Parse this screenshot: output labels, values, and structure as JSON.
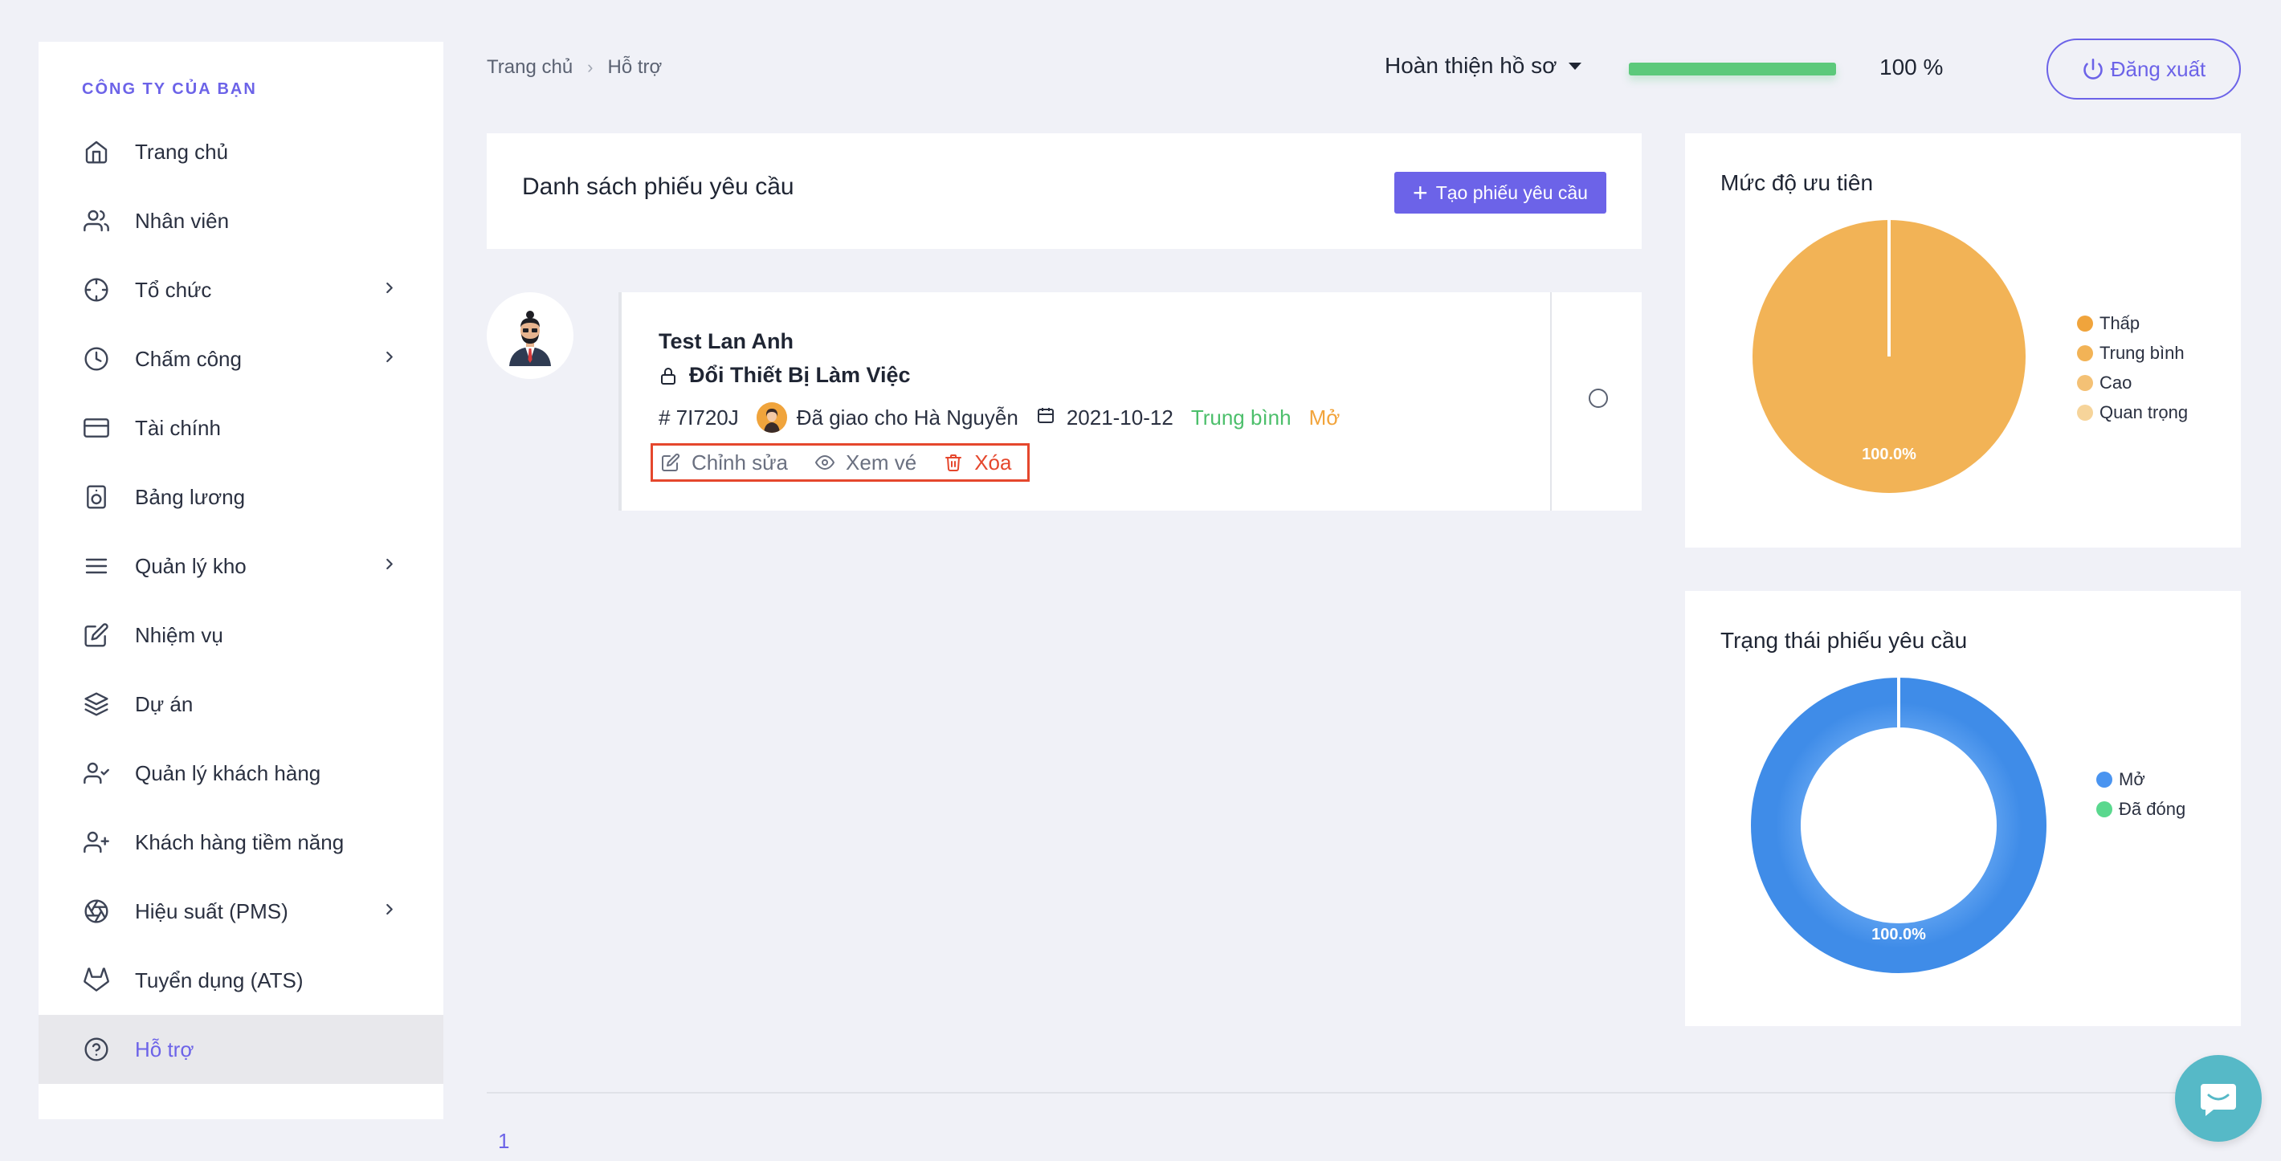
{
  "sidebar": {
    "company": "CÔNG TY CỦA BẠN",
    "items": [
      {
        "label": "Trang chủ",
        "icon": "home-icon",
        "chevron": false,
        "active": false
      },
      {
        "label": "Nhân viên",
        "icon": "users-icon",
        "chevron": false,
        "active": false
      },
      {
        "label": "Tổ chức",
        "icon": "crosshair-icon",
        "chevron": true,
        "active": false
      },
      {
        "label": "Chấm công",
        "icon": "clock-icon",
        "chevron": true,
        "active": false
      },
      {
        "label": "Tài chính",
        "icon": "credit-card-icon",
        "chevron": false,
        "active": false
      },
      {
        "label": "Bảng lương",
        "icon": "speaker-icon",
        "chevron": false,
        "active": false
      },
      {
        "label": "Quản lý kho",
        "icon": "menu-icon",
        "chevron": true,
        "active": false
      },
      {
        "label": "Nhiệm vụ",
        "icon": "edit-icon",
        "chevron": false,
        "active": false
      },
      {
        "label": "Dự án",
        "icon": "layers-icon",
        "chevron": false,
        "active": false
      },
      {
        "label": "Quản lý khách hàng",
        "icon": "user-check-icon",
        "chevron": false,
        "active": false
      },
      {
        "label": "Khách hàng tiềm năng",
        "icon": "user-plus-icon",
        "chevron": false,
        "active": false
      },
      {
        "label": "Hiệu suất (PMS)",
        "icon": "aperture-icon",
        "chevron": true,
        "active": false
      },
      {
        "label": "Tuyển dụng (ATS)",
        "icon": "gitlab-icon",
        "chevron": false,
        "active": false
      },
      {
        "label": "Hỗ trợ",
        "icon": "help-circle-icon",
        "chevron": false,
        "active": true
      }
    ]
  },
  "header": {
    "breadcrumb": {
      "home": "Trang chủ",
      "separator": "›",
      "current": "Hỗ trợ"
    },
    "profile_dropdown": "Hoàn thiện hồ sơ",
    "progress": {
      "value": 100,
      "label": "100 %",
      "color": "#5cc97b"
    },
    "logout_label": "Đăng xuất"
  },
  "tickets": {
    "title": "Danh sách phiếu yêu cầu",
    "create_label": "Tạo phiếu yêu cầu",
    "items": [
      {
        "name": "Test Lan Anh",
        "subject": "Đổi Thiết Bị Làm Việc",
        "id": "# 7I720J",
        "assigned": "Đã giao cho Hà Nguyễn",
        "date": "2021-10-12",
        "priority": "Trung bình",
        "status": "Mở",
        "actions": {
          "edit": "Chỉnh sửa",
          "view": "Xem vé",
          "delete": "Xóa"
        }
      }
    ]
  },
  "chart_data": [
    {
      "type": "pie",
      "title": "Mức độ ưu tiên",
      "categories": [
        "Thấp",
        "Trung bình",
        "Cao",
        "Quan trọng"
      ],
      "values": [
        0,
        100,
        0,
        0
      ],
      "colors": [
        "#f0a43c",
        "#f2b356",
        "#f4c175",
        "#f6d49a"
      ],
      "data_labels": [
        "100.0%"
      ],
      "legend": "right"
    },
    {
      "type": "pie",
      "title": "Trạng thái phiếu yêu cầu",
      "categories": [
        "Mở",
        "Đã đóng"
      ],
      "values": [
        100,
        0
      ],
      "colors": [
        "#4a94f0",
        "#5ad88e"
      ],
      "data_labels": [
        "100.0%"
      ],
      "legend": "right",
      "donut": true
    }
  ],
  "pagination": {
    "current": "1"
  },
  "colors": {
    "accent": "#6c63e8",
    "danger": "#e5472d",
    "success": "#4cbf6b",
    "warning": "#f2a43b"
  }
}
